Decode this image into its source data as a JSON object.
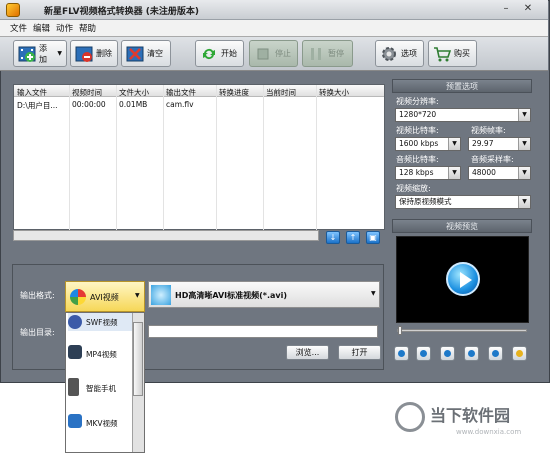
{
  "window": {
    "title": "新星FLV视频格式转换器 (未注册版本)"
  },
  "menu": [
    "文件",
    "编辑",
    "动作",
    "帮助"
  ],
  "toolbar": {
    "add": "添加",
    "delete": "删除",
    "clear": "清空",
    "start": "开始",
    "stop": "停止",
    "pause": "暂停",
    "options": "选项",
    "buy": "购买"
  },
  "file_list": {
    "columns": [
      "输入文件",
      "视频时间",
      "文件大小",
      "输出文件",
      "转换进度",
      "当前时间",
      "转换大小"
    ],
    "rows": [
      [
        "D:\\用户目...",
        "00:00:00",
        "0.01MB",
        "cam.flv",
        "",
        "",
        ""
      ]
    ]
  },
  "preset": {
    "header": "预置选项",
    "resolution_label": "视频分辨率:",
    "resolution": "1280*720",
    "video_bitrate_label": "视频比特率:",
    "video_bitrate": "1600 kbps",
    "framerate_label": "视频帧率:",
    "framerate": "29.97",
    "audio_bitrate_label": "音频比特率:",
    "audio_bitrate": "128 kbps",
    "samplerate_label": "音频采样率:",
    "samplerate": "48000",
    "scale_label": "视频缩放:",
    "scale": "保持原视频模式"
  },
  "preview": {
    "header": "视频预览"
  },
  "output": {
    "format_label": "输出格式:",
    "format": "AVI视频",
    "profile": "HD高清晰AVI标准视频(*.avi)",
    "dir_label": "输出目录:",
    "dir_value": "",
    "browse": "浏览...",
    "open": "打开"
  },
  "format_dropdown": [
    "SWF视频",
    "MP4视频",
    "智能手机",
    "MKV视频"
  ],
  "watermark": {
    "brand": "当下软件园",
    "url": "www.downxia.com"
  }
}
